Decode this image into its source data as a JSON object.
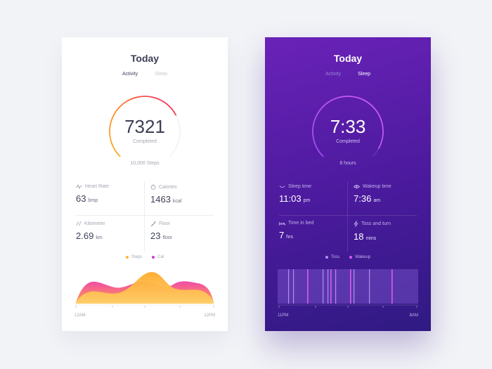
{
  "activity_card": {
    "title": "Today",
    "tabs": [
      {
        "label": "Activity",
        "active": true
      },
      {
        "label": "Sleep",
        "active": false
      }
    ],
    "main_value": "7321",
    "main_caption": "Completed",
    "goal": "10,000 Steps",
    "progress": 0.73,
    "stats": [
      {
        "icon": "heart-rate-icon",
        "label": "Heart Rate",
        "value": "63",
        "unit": "bmp"
      },
      {
        "icon": "calories-icon",
        "label": "Calories",
        "value": "1463",
        "unit": "kcal"
      },
      {
        "icon": "kilometer-icon",
        "label": "Kilometer",
        "value": "2.69",
        "unit": "km"
      },
      {
        "icon": "floor-icon",
        "label": "Floor",
        "value": "23",
        "unit": "floor"
      }
    ],
    "legend": [
      {
        "label": "Steps",
        "color": "#ffb43c"
      },
      {
        "label": "Cal",
        "color": "#c83cd6"
      }
    ],
    "axis": {
      "start": "12AM",
      "end": "12PM"
    },
    "colors": {
      "ring_start": "#ffb026",
      "ring_end": "#e8206a",
      "steps": "#ffb43c",
      "cal": "#f04aa8"
    }
  },
  "sleep_card": {
    "title": "Today",
    "tabs": [
      {
        "label": "Activity",
        "active": false
      },
      {
        "label": "Sleep",
        "active": true
      }
    ],
    "main_value": "7:33",
    "main_caption": "Completed",
    "goal": "8 hours",
    "progress": 0.94,
    "stats": [
      {
        "icon": "sleep-time-icon",
        "label": "Sleep time",
        "value": "11:03",
        "unit": "pm"
      },
      {
        "icon": "wakeup-time-icon",
        "label": "Wakeup time",
        "value": "7:36",
        "unit": "am"
      },
      {
        "icon": "time-in-bed-icon",
        "label": "Time in bed",
        "value": "7",
        "unit": "hrs"
      },
      {
        "icon": "toss-and-turn-icon",
        "label": "Toss and turn",
        "value": "18",
        "unit": "mins"
      }
    ],
    "legend": [
      {
        "label": "Toss",
        "color": "#b58cf0"
      },
      {
        "label": "Wakeup",
        "color": "#d65cf2"
      }
    ],
    "axis": {
      "start": "11PM",
      "end": "8AM"
    },
    "colors": {
      "ring": "#c04cf0",
      "toss": "#b58cf0",
      "wakeup": "#d65cf2"
    }
  }
}
